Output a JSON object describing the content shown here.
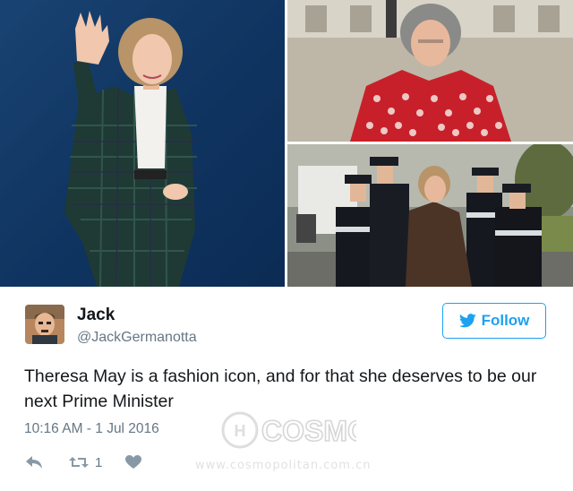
{
  "tweet": {
    "user_name": "Jack",
    "user_handle": "@JackGermanotta",
    "follow_label": "Follow",
    "text": "Theresa May is a fashion icon, and for that she deserves to be our next Prime Minister",
    "timestamp": "10:16 AM - 1 Jul 2016",
    "retweet_count": "1"
  },
  "watermark": {
    "logo_text": "COSMO",
    "url": "www.cosmopolitan.com.cn"
  },
  "icons": {
    "follow": "twitter-bird-icon",
    "reply": "reply-icon",
    "retweet": "retweet-icon",
    "like": "heart-icon"
  },
  "colors": {
    "brand_blue": "#1da1f2",
    "secondary_text": "#657786",
    "action_icon": "#8899a6"
  }
}
